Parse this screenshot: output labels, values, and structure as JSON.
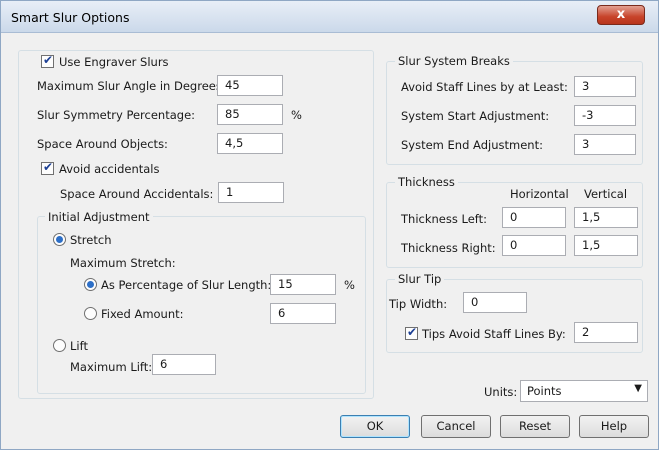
{
  "window": {
    "title": "Smart Slur Options",
    "close_label": "x"
  },
  "left": {
    "use_engraver_slurs": {
      "label": "Use Engraver Slurs",
      "checked": true
    },
    "max_slur_angle": {
      "label": "Maximum Slur Angle in Degrees:",
      "value": "45"
    },
    "slur_symmetry": {
      "label": "Slur Symmetry Percentage:",
      "value": "85",
      "unit": "%"
    },
    "space_around_objects": {
      "label": "Space Around Objects:",
      "value": "4,5"
    },
    "avoid_accidentals": {
      "label": "Avoid accidentals",
      "checked": true
    },
    "space_around_accidentals": {
      "label": "Space Around Accidentals:",
      "value": "1"
    },
    "initial_adjustment": {
      "legend": "Initial Adjustment",
      "stretch": {
        "label": "Stretch",
        "selected": true
      },
      "maximum_stretch_label": "Maximum Stretch:",
      "as_percentage": {
        "label": "As Percentage of Slur Length:",
        "value": "15",
        "unit": "%",
        "selected": true
      },
      "fixed_amount": {
        "label": "Fixed Amount:",
        "value": "6",
        "selected": false
      },
      "lift": {
        "label": "Lift",
        "selected": false
      },
      "maximum_lift": {
        "label": "Maximum Lift:",
        "value": "6"
      }
    }
  },
  "right": {
    "system_breaks": {
      "legend": "Slur System Breaks",
      "avoid_staff_lines": {
        "label": "Avoid Staff Lines by at Least:",
        "value": "3"
      },
      "system_start": {
        "label": "System Start Adjustment:",
        "value": "-3"
      },
      "system_end": {
        "label": "System End Adjustment:",
        "value": "3"
      }
    },
    "thickness": {
      "legend": "Thickness",
      "col_horizontal": "Horizontal",
      "col_vertical": "Vertical",
      "left": {
        "label": "Thickness Left:",
        "horizontal": "0",
        "vertical": "1,5"
      },
      "right": {
        "label": "Thickness Right:",
        "horizontal": "0",
        "vertical": "1,5"
      }
    },
    "slur_tip": {
      "legend": "Slur Tip",
      "tip_width": {
        "label": "Tip Width:",
        "value": "0"
      },
      "tips_avoid": {
        "label": "Tips Avoid Staff Lines By:",
        "value": "2",
        "checked": true
      }
    },
    "units": {
      "label": "Units:",
      "selected": "Points"
    }
  },
  "buttons": {
    "ok": "OK",
    "cancel": "Cancel",
    "reset": "Reset",
    "help": "Help"
  }
}
